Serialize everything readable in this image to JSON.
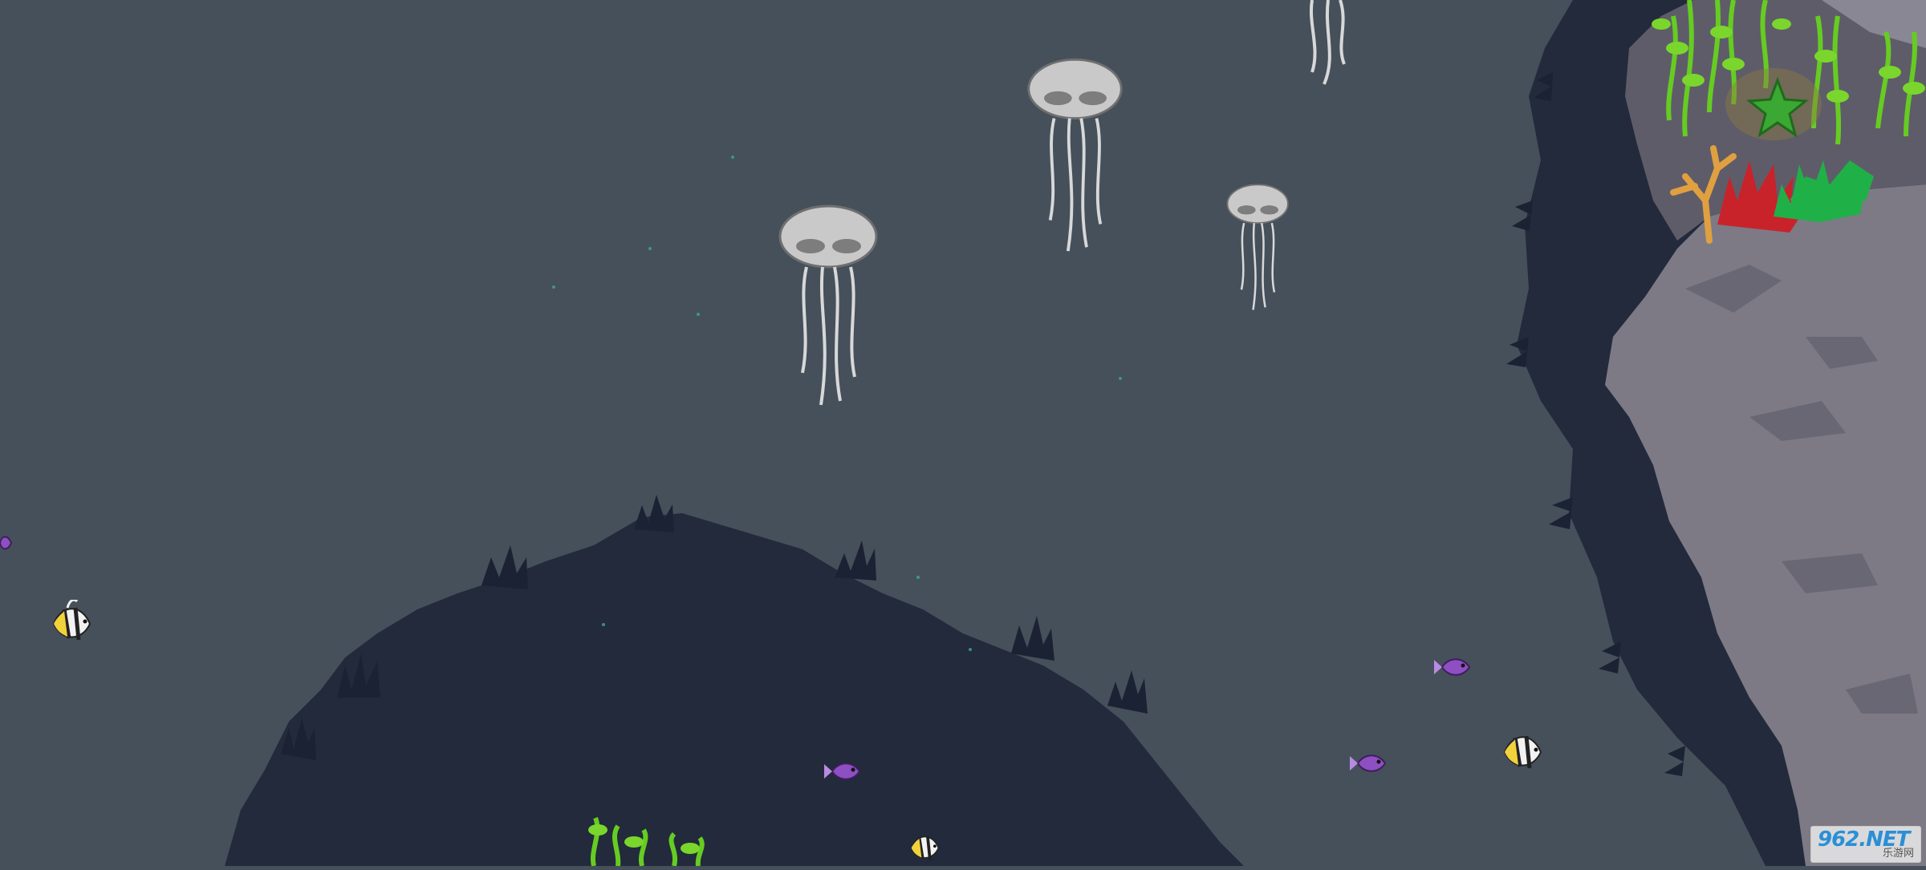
{
  "game": {
    "scene": "underwater-reef",
    "hud": null
  },
  "colors": {
    "water": "#45505b",
    "deep_trench": "#222a3c",
    "rock": "#7d7a86",
    "rock_shadow": "#5f5c69",
    "jellyfish_bell": "#c9c9c9",
    "seaweed": "#66cc22",
    "starfish": "#3aa832",
    "coral_red": "#c8232a",
    "coral_orange": "#e0a040",
    "coral_green": "#20b048",
    "fish_yellow": "#f2d23a",
    "fish_purple": "#8e4fc2"
  },
  "entities": {
    "jellyfish": [
      "jellyfish",
      "jellyfish",
      "jellyfish",
      "jellyfish"
    ],
    "fish": [
      "bannerfish",
      "bannerfish",
      "bannerfish",
      "purple-fish",
      "purple-fish",
      "purple-fish",
      "purple-fish"
    ],
    "decor": [
      "seaweed",
      "starfish",
      "coral"
    ]
  },
  "watermark": {
    "main": "962.NET",
    "sub": "乐游网"
  }
}
